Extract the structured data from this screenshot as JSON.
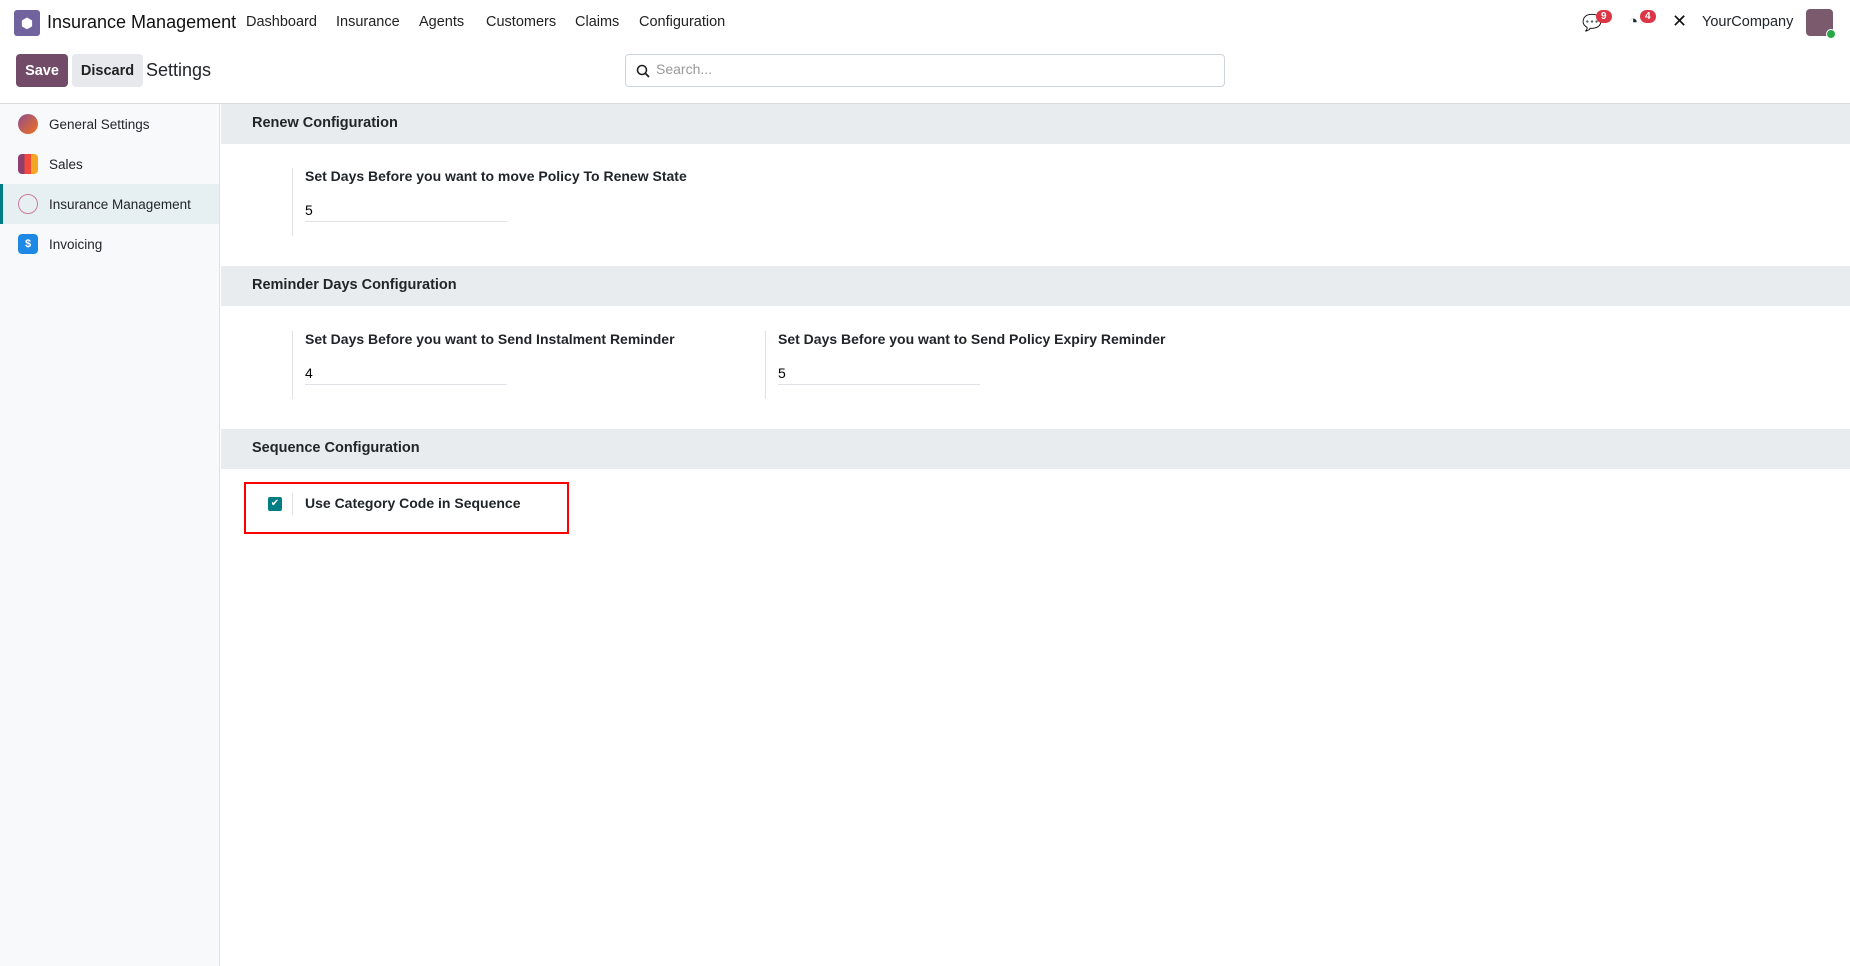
{
  "topbar": {
    "app_title": "Insurance Management",
    "nav": [
      "Dashboard",
      "Insurance",
      "Agents",
      "Customers",
      "Claims",
      "Configuration"
    ],
    "messages_count": "9",
    "activities_count": "4",
    "company": "YourCompany"
  },
  "control": {
    "save_label": "Save",
    "discard_label": "Discard",
    "page_title": "Settings",
    "search_placeholder": "Search..."
  },
  "sidebar": {
    "items": [
      {
        "label": "General Settings"
      },
      {
        "label": "Sales"
      },
      {
        "label": "Insurance Management"
      },
      {
        "label": "Invoicing"
      }
    ]
  },
  "sections": {
    "renew": {
      "title": "Renew Configuration",
      "field_label": "Set Days Before you want to move Policy To Renew State",
      "field_value": "5"
    },
    "reminder": {
      "title": "Reminder Days Configuration",
      "instalment_label": "Set Days Before you want to Send Instalment Reminder",
      "instalment_value": "4",
      "expiry_label": "Set Days Before you want to Send Policy Expiry Reminder",
      "expiry_value": "5"
    },
    "sequence": {
      "title": "Sequence Configuration",
      "checkbox_label": "Use Category Code in Sequence",
      "checked": true
    }
  },
  "colors": {
    "brand": "#714b67",
    "accent": "#017e84",
    "highlight": "#ff0000"
  }
}
